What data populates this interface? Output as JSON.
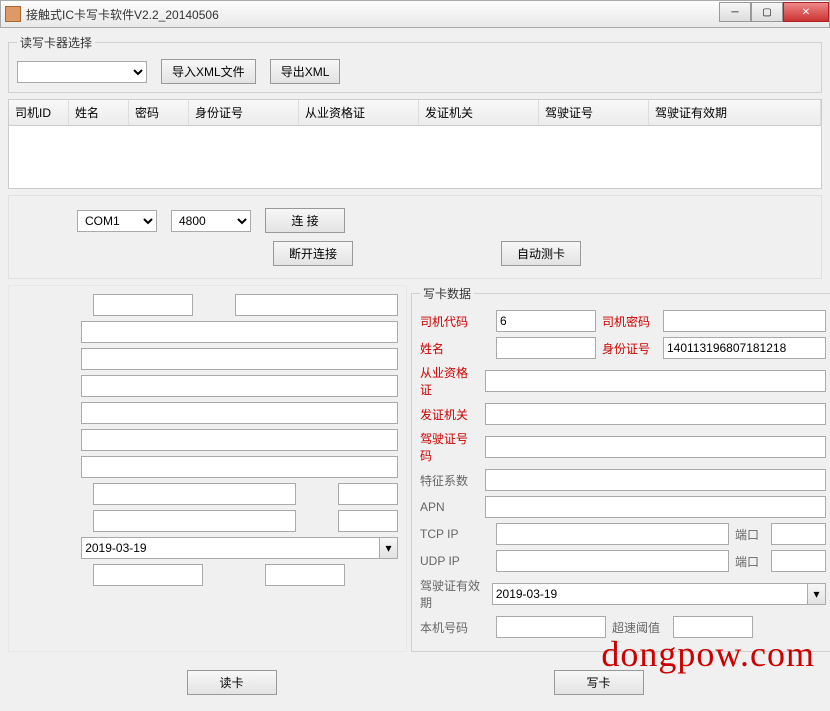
{
  "window": {
    "title": "接触式IC卡写卡软件V2.2_20140506"
  },
  "reader": {
    "legend": "读写卡器选择",
    "import_btn": "导入XML文件",
    "export_btn": "导出XML"
  },
  "grid": {
    "cols": [
      "司机ID",
      "姓名",
      "密码",
      "身份证号",
      "从业资格证",
      "发证机关",
      "驾驶证号",
      "驾驶证有效期"
    ]
  },
  "conn": {
    "com": "COM1",
    "baud": "4800",
    "connect_btn": "连    接",
    "disconnect_btn": "断开连接",
    "autotest_btn": "自动测卡"
  },
  "write": {
    "legend": "写卡数据",
    "driver_code_lbl": "司机代码",
    "driver_code_val": "6",
    "driver_pwd_lbl": "司机密码",
    "driver_pwd_val": "",
    "name_lbl": "姓名",
    "name_val": "",
    "id_lbl": "身份证号",
    "id_val": "140113196807181218",
    "qual_lbl": "从业资格证",
    "qual_val": "",
    "issuer_lbl": "发证机关",
    "issuer_val": "",
    "license_lbl": "驾驶证号码",
    "license_val": "",
    "feature_lbl": "特征系数",
    "feature_val": "",
    "apn_lbl": "APN",
    "apn_val": "",
    "tcp_lbl": "TCP IP",
    "tcp_val": "",
    "port_lbl": "端口",
    "tcp_port_val": "",
    "udp_lbl": "UDP IP",
    "udp_val": "",
    "udp_port_val": "",
    "expiry_lbl": "驾驶证有效期",
    "expiry_val": "2019-03-19",
    "local_lbl": "本机号码",
    "local_val": "",
    "speed_lbl": "超速阈值",
    "speed_val": ""
  },
  "left_date_val": "2019-03-19",
  "bottom": {
    "read_btn": "读卡",
    "write_btn": "写卡"
  },
  "logo": "dongpow.com"
}
